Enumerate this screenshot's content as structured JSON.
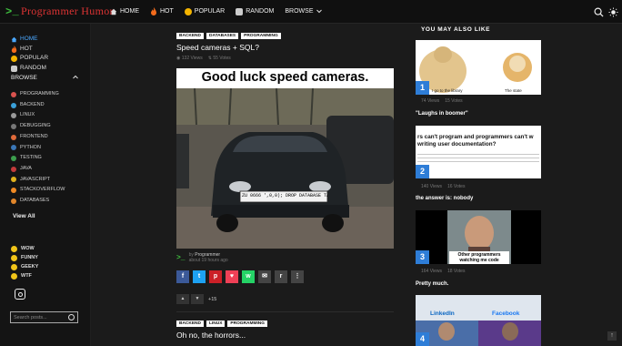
{
  "brand": {
    "name": "Programmer Humor",
    "prompt": ">_"
  },
  "topnav": [
    {
      "label": "HOME",
      "icon": "home-icon"
    },
    {
      "label": "HOT",
      "icon": "fire-icon"
    },
    {
      "label": "POPULAR",
      "icon": "popular-icon"
    },
    {
      "label": "RANDOM",
      "icon": "dice-icon"
    },
    {
      "label": "BROWSE",
      "icon": "chevron-down-icon"
    }
  ],
  "sidebar": {
    "main": [
      {
        "label": "HOME",
        "active": true
      },
      {
        "label": "HOT"
      },
      {
        "label": "POPULAR"
      },
      {
        "label": "RANDOM"
      }
    ],
    "browse_label": "BROWSE",
    "categories": [
      {
        "label": "PROGRAMMING",
        "color": "#d9534f"
      },
      {
        "label": "BACKEND",
        "color": "#3aa0d9"
      },
      {
        "label": "LINUX",
        "color": "#999999"
      },
      {
        "label": "DEBUGGING",
        "color": "#777777"
      },
      {
        "label": "FRONTEND",
        "color": "#e06a3a"
      },
      {
        "label": "PYTHON",
        "color": "#3b77b7"
      },
      {
        "label": "TESTING",
        "color": "#3c9e4d"
      },
      {
        "label": "JAVA",
        "color": "#c23b3b"
      },
      {
        "label": "JAVASCRIPT",
        "color": "#e0b21e"
      },
      {
        "label": "STACKOVERFLOW",
        "color": "#f08a24"
      },
      {
        "label": "DATABASES",
        "color": "#e2872b"
      }
    ],
    "view_all": "View All",
    "moods": [
      "WOW",
      "FUNNY",
      "GEEKY",
      "WTF"
    ],
    "search_placeholder": "Search posts..."
  },
  "posts": [
    {
      "tags": [
        "BACKEND",
        "DATABASES",
        "PROGRAMMING"
      ],
      "title": "Speed cameras + SQL?",
      "views": "132 Views",
      "votes": "55 Votes",
      "image_caption": "Good luck speed cameras.",
      "plate_text": "ZU 0666 ',0,0); DROP DATABASE TABLE",
      "author_by": "by",
      "author": "Programmer",
      "time": "about 19 hours ago",
      "score": "+15",
      "up": "▲",
      "down": "▼"
    },
    {
      "tags": [
        "BACKEND",
        "LINUX",
        "PROGRAMMING"
      ],
      "title": "Oh no, the horrors..."
    }
  ],
  "right_column": {
    "heading": "YOU MAY ALSO LIKE",
    "cards": [
      {
        "num": "1",
        "views": "74 Views",
        "votes": "15 Votes",
        "title": "\"Laughs in boomer\"",
        "img_left": "I go to the library",
        "img_right": "The state"
      },
      {
        "num": "2",
        "views": "140 Views",
        "votes": "16 Votes",
        "title": "the answer is: nobody",
        "img_line1": "rs can't program and programmers can't w",
        "img_line2": "writing user documentation?"
      },
      {
        "num": "3",
        "views": "164 Views",
        "votes": "18 Votes",
        "title": "Pretty much.",
        "img_caption": "Other programmers watching me code"
      },
      {
        "num": "4",
        "img_a": "LinkedIn",
        "img_b": "Facebook"
      }
    ]
  },
  "share_buttons": [
    {
      "name": "facebook",
      "color": "#3b5998",
      "glyph": "f"
    },
    {
      "name": "twitter",
      "color": "#1da1f2",
      "glyph": "t"
    },
    {
      "name": "pinterest",
      "color": "#cb2027",
      "glyph": "p"
    },
    {
      "name": "pocket",
      "color": "#ef4056",
      "glyph": "♥"
    },
    {
      "name": "whatsapp",
      "color": "#25d366",
      "glyph": "w"
    },
    {
      "name": "email",
      "color": "#444444",
      "glyph": "✉"
    },
    {
      "name": "reddit",
      "color": "#444444",
      "glyph": "r"
    },
    {
      "name": "more",
      "color": "#444444",
      "glyph": "⋮"
    }
  ]
}
